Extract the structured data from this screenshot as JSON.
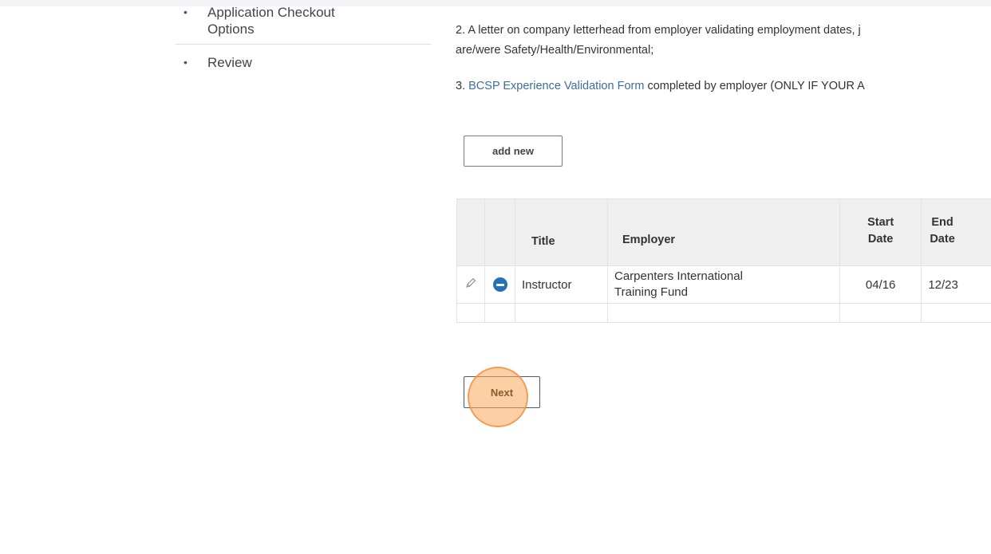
{
  "sidebar": {
    "items": [
      {
        "label": "Application Checkout Options",
        "line1": "Application Checkout",
        "line2": "Options"
      },
      {
        "label": "Review"
      }
    ]
  },
  "instructions": {
    "item2_line1": "2. A letter on company letterhead from employer validating employment dates, j",
    "item2_line2": "are/were Safety/Health/Environmental;",
    "item3_prefix": "3. ",
    "item3_link": "BCSP Experience Validation Form",
    "item3_suffix": " completed by employer (ONLY IF YOUR A"
  },
  "buttons": {
    "add_new": "add new",
    "next": "Next"
  },
  "table": {
    "headers": {
      "title": "Title",
      "employer": "Employer",
      "start_date_l1": "Start",
      "start_date_l2": "Date",
      "end_date_l1": "End",
      "end_date_l2": "Date"
    },
    "rows": [
      {
        "title": "Instructor",
        "employer_l1": "Carpenters International",
        "employer_l2": "Training Fund",
        "start_date": "04/16",
        "end_date": "12/23"
      }
    ]
  },
  "colors": {
    "link": "#3d6e9c",
    "delete_icon": "#2471b7",
    "click_highlight": "#f8a24f"
  }
}
